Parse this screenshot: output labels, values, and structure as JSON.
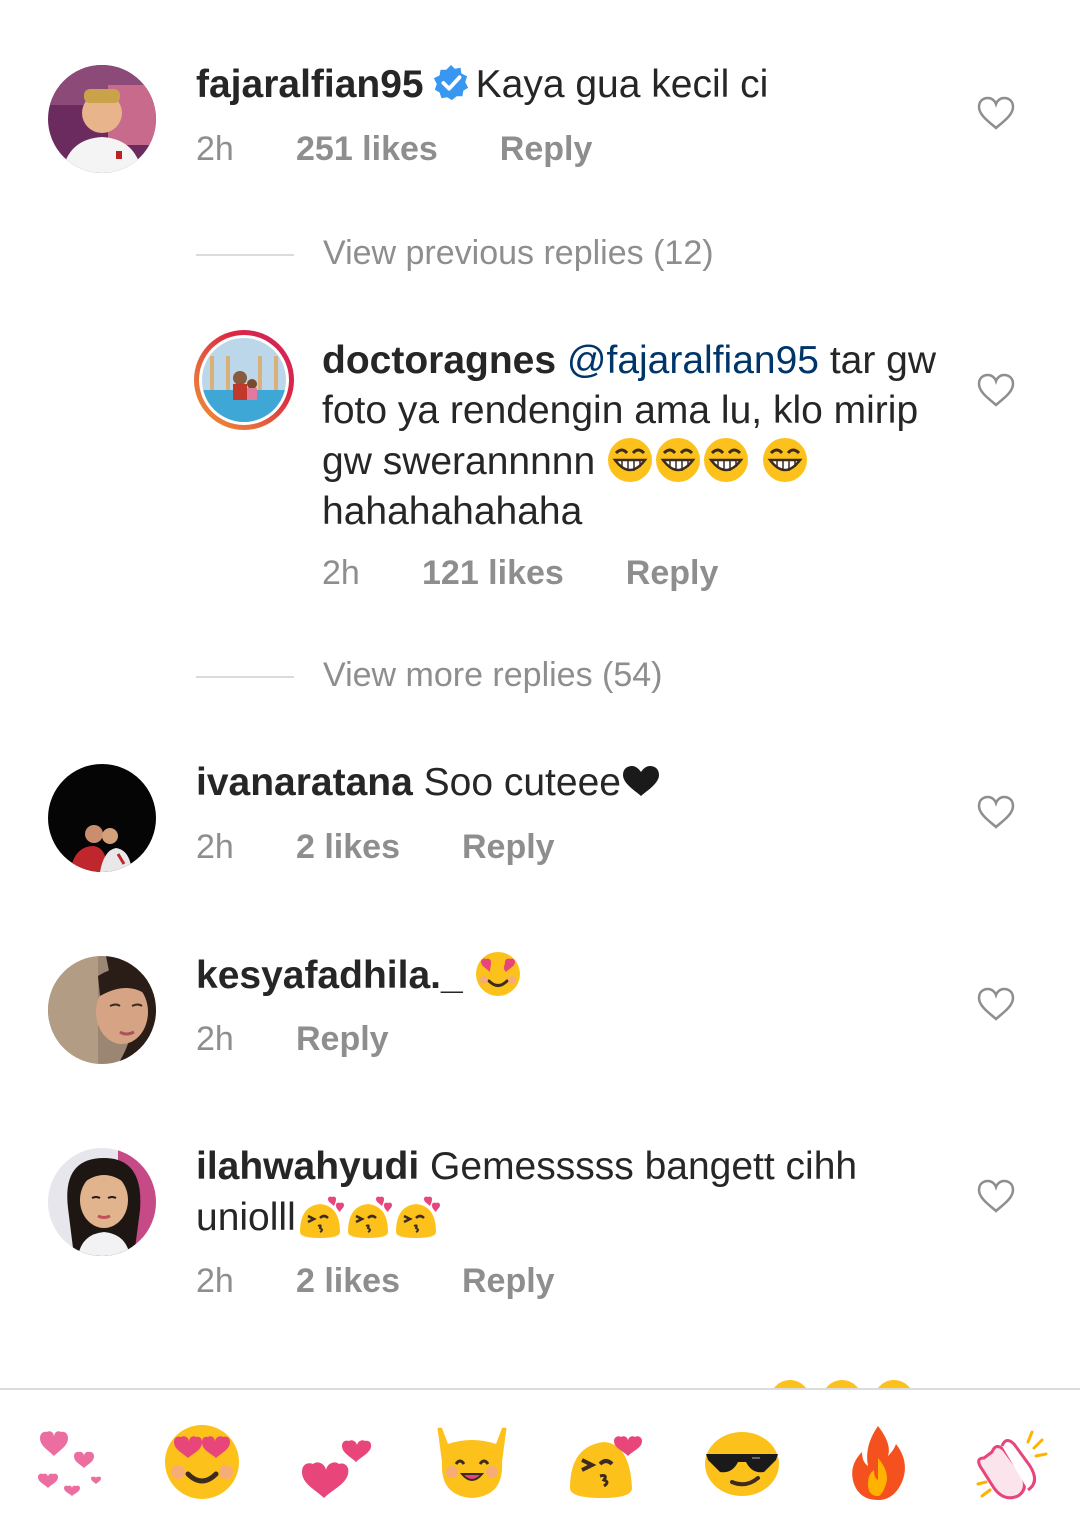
{
  "comments": [
    {
      "username": "fajaralfian95",
      "verified": true,
      "text": "Kaya gua kecil ci",
      "time": "2h",
      "likes": "251 likes",
      "reply": "Reply"
    },
    {
      "username": "doctoragnes",
      "mention": "@fajaralfian95",
      "text": "tar gw foto ya rendengin ama lu, klo mirip gw swerannnnn",
      "text_tail": "hahahahahaha",
      "time": "2h",
      "likes": "121 likes",
      "reply": "Reply"
    },
    {
      "username": "ivanaratana",
      "text": "Soo cuteee",
      "time": "2h",
      "likes": "2 likes",
      "reply": "Reply"
    },
    {
      "username": "kesyafadhila._",
      "text": "",
      "time": "2h",
      "reply": "Reply"
    },
    {
      "username": "ilahwahyudi",
      "text": "Gemesssss bangett cihh",
      "text_line2": "uniolll",
      "time": "2h",
      "likes": "2 likes",
      "reply": "Reply"
    }
  ],
  "view_previous_replies": "View previous replies (12)",
  "view_more_replies": "View more replies (54)",
  "emoji_bar": [
    "hearts-icon",
    "heart-eyes-icon",
    "two-hearts-icon",
    "raised-hands-icon",
    "kissing-heart-icon",
    "sunglasses-icon",
    "fire-icon",
    "clapping-icon"
  ],
  "colors": {
    "text": "#262626",
    "secondary": "#8e8e8e",
    "mention": "#003569",
    "verified": "#3897f0",
    "divider": "#dbdbdb"
  }
}
